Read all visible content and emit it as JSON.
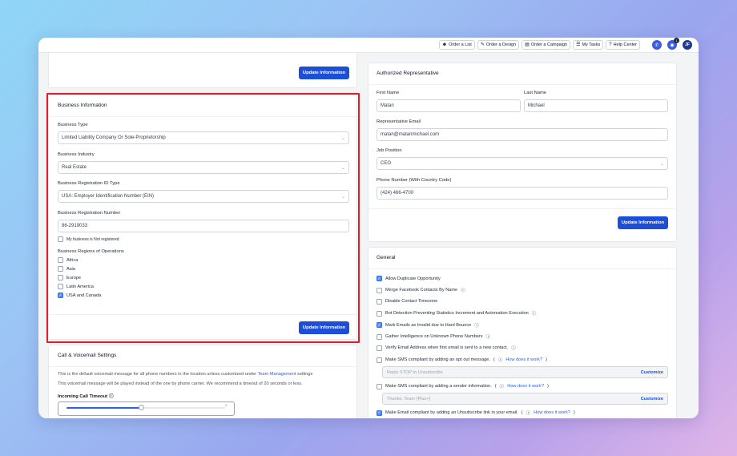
{
  "topbar": {
    "order_list": "Order a List",
    "order_design": "Order a Design",
    "order_campaign": "Order a Campaign",
    "my_tasks": "My Tasks",
    "help_center": "Help Center",
    "notification_count": "1",
    "avatar_initials": "JF"
  },
  "left": {
    "top_update_label": "Update Information",
    "business": {
      "title": "Business Information",
      "type_label": "Business Type",
      "type_value": "Limited Liability Company Or Sole-Proprietorship",
      "industry_label": "Business Industry",
      "industry_value": "Real Estate",
      "reg_id_type_label": "Business Registration ID Type",
      "reg_id_type_value": "USA: Employer Identification Number (EIN)",
      "reg_number_label": "Business Registration Number",
      "reg_number_value": "86-2919033",
      "not_registered_label": "My business is Not registered",
      "regions_label": "Business Regions of Operations",
      "regions": [
        {
          "label": "Africa",
          "checked": false
        },
        {
          "label": "Asia",
          "checked": false
        },
        {
          "label": "Europe",
          "checked": false
        },
        {
          "label": "Latin America",
          "checked": false
        },
        {
          "label": "USA and Canada",
          "checked": true
        }
      ],
      "update_label": "Update Information"
    },
    "call": {
      "title": "Call & Voicemail Settings",
      "line1_pre": "This is the default voicemail message for all phone numbers in the location unless customized under",
      "line1_link": "Team Management",
      "line1_post": "settings",
      "line2": "This voicemail message will be played instead of the one by phone carrier. We recommend a timeout of 20 seconds or less.",
      "timeout_label": "Incoming Call Timeout",
      "timeout_fraction": 0.47
    }
  },
  "right": {
    "rep": {
      "title": "Authorized Representative",
      "first_name_label": "First Name",
      "first_name_value": "Matan",
      "last_name_label": "Last Name",
      "last_name_value": "Michael",
      "email_label": "Representative Email",
      "email_value": "matan@matanmichael.com",
      "position_label": "Job Position",
      "position_value": "CEO",
      "phone_label": "Phone Number (With Country Code)",
      "phone_value": "(424) 466-4700",
      "update_label": "Update Information"
    },
    "general": {
      "title": "General",
      "options": [
        {
          "label": "Allow Duplicate Opportunity",
          "checked": true,
          "info": false
        },
        {
          "label": "Merge Facebook Contacts By Name",
          "checked": false,
          "info": true
        },
        {
          "label": "Disable Contact Timezone",
          "checked": false,
          "info": false
        },
        {
          "label": "Bot Detection Preventing Statistics Increment and Automation Execution",
          "checked": false,
          "info": true
        },
        {
          "label": "Mark Emails as Invalid due to Hard Bounce",
          "checked": true,
          "info": true
        },
        {
          "label": "Gather Intelligence on Unknown Phone Numbers",
          "checked": false,
          "info": true
        },
        {
          "label": "Verify Email Address when first email is sent to a new contact.",
          "checked": false,
          "info": true
        }
      ],
      "sms_opt_out_label": "Make SMS compliant by adding an opt out message.",
      "how_link": "How does it work?",
      "sms_opt_out_placeholder": "Reply STOP to Unsubscribe",
      "customize_label": "Customize",
      "sms_sender_label": "Make SMS compliant by adding a sender information.",
      "sms_sender_placeholder": "Thanks, Team {Plus+}",
      "email_unsub_label": "Make Email compliant by adding an Unsubscribe link in your email."
    }
  }
}
